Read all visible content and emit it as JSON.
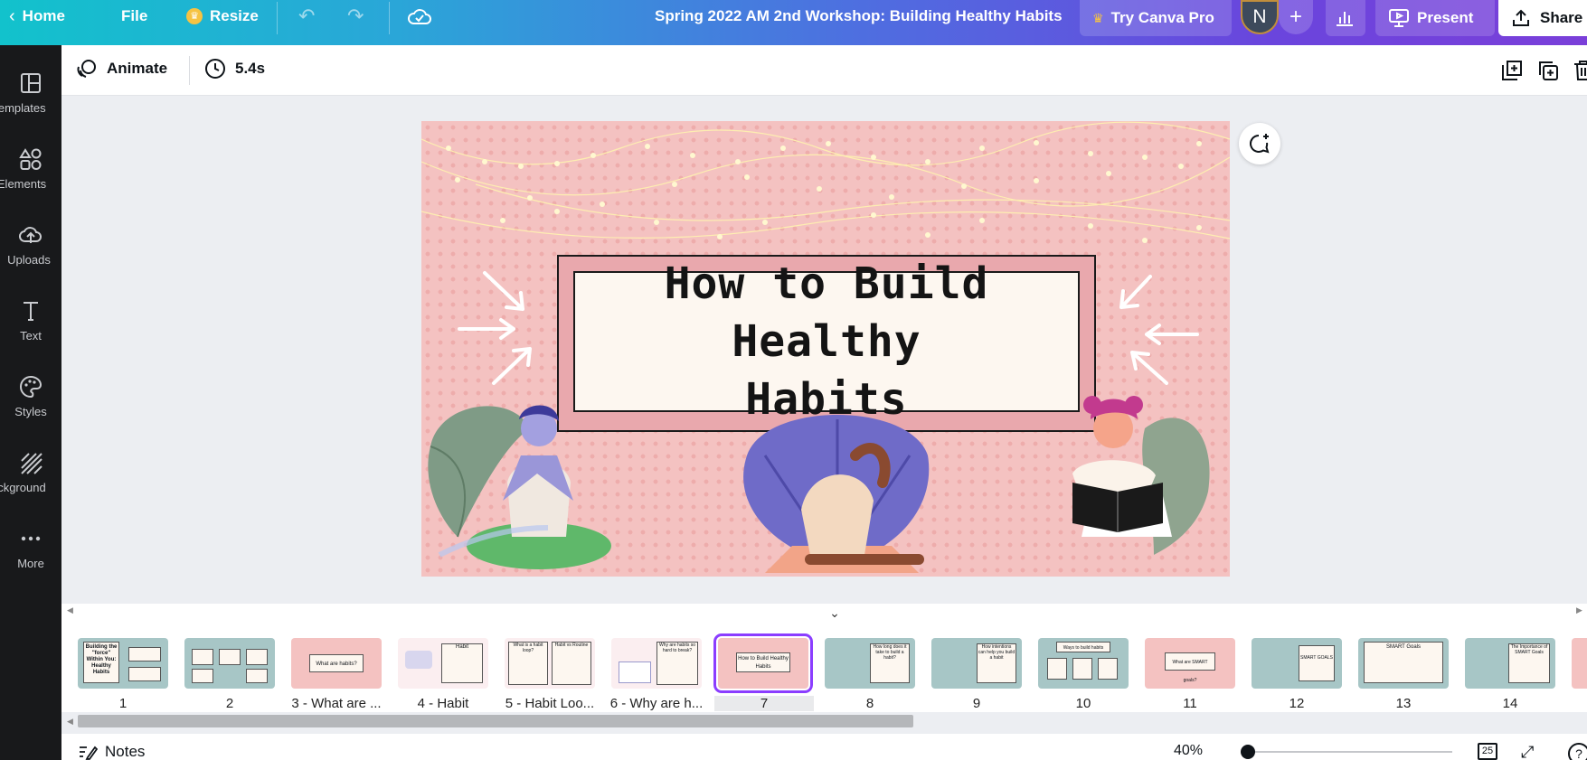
{
  "topbar": {
    "home_label": "Home",
    "file_label": "File",
    "resize_label": "Resize",
    "doc_title": "Spring 2022 AM 2nd Workshop: Building Healthy Habits",
    "try_pro_label": "Try Canva Pro",
    "avatar_initial": "N",
    "present_label": "Present",
    "share_label": "Share"
  },
  "sidebar": {
    "items": [
      {
        "label": "Templates",
        "icon": "templates-icon"
      },
      {
        "label": "Elements",
        "icon": "elements-icon"
      },
      {
        "label": "Uploads",
        "icon": "uploads-icon"
      },
      {
        "label": "Text",
        "icon": "text-icon"
      },
      {
        "label": "Styles",
        "icon": "styles-icon"
      },
      {
        "label": "Background",
        "icon": "background-icon"
      },
      {
        "label": "More",
        "icon": "more-icon"
      }
    ]
  },
  "toolbar": {
    "animate_label": "Animate",
    "duration_label": "5.4s"
  },
  "slide": {
    "title_line1": "How to Build Healthy",
    "title_line2": "Habits"
  },
  "filmstrip": {
    "selected_page": "7",
    "pages": [
      {
        "label": "1"
      },
      {
        "label": "2"
      },
      {
        "label": "3 - What are ..."
      },
      {
        "label": "4 - Habit"
      },
      {
        "label": "5 - Habit Loo..."
      },
      {
        "label": "6 - Why are h..."
      },
      {
        "label": "7"
      },
      {
        "label": "8"
      },
      {
        "label": "9"
      },
      {
        "label": "10"
      },
      {
        "label": "11"
      },
      {
        "label": "12"
      },
      {
        "label": "13"
      },
      {
        "label": "14"
      }
    ],
    "thumb_titles": {
      "t1": "Building the \"force\" Within You: Healthy Habits",
      "t3": "What are habits?",
      "t4": "Habit",
      "t5a": "What is a habit loop?",
      "t5b": "Habit vs Routine",
      "t6": "Why are habits so hard to break?",
      "t7": "How to Build Healthy Habits",
      "t8": "How long does it take to build a habit?",
      "t9": "How intentions can help you build a habit",
      "t10": "Ways to build habits",
      "t11": "What are SMART goals?",
      "t12": "SMART GOALS",
      "t13": "SMART Goals",
      "t14": "The Importance of SMART Goals"
    }
  },
  "footer": {
    "notes_label": "Notes",
    "zoom_label": "40%",
    "zoom_fraction": 0.02,
    "page_count": "25"
  },
  "colors": {
    "slide_bg": "#f4c2c1",
    "frame_pink": "#e9a8ad",
    "accent": "#8b3dff",
    "thumb_teal": "#9dbfbf"
  }
}
